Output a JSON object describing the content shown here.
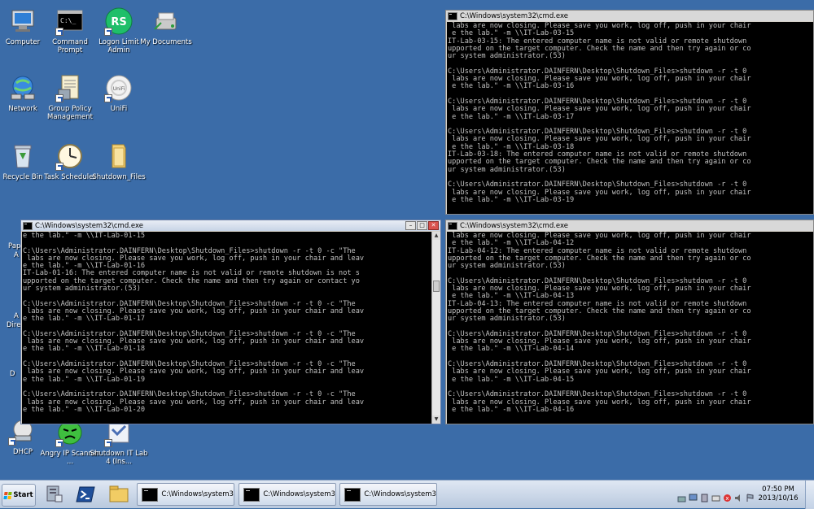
{
  "desktop": {
    "icons": [
      {
        "label": "Computer",
        "icon": "computer-icon"
      },
      {
        "label": "Command Prompt",
        "icon": "command-prompt-icon"
      },
      {
        "label": "Logon Limit Admin",
        "icon": "logon-limit-admin-icon",
        "badge": "RS"
      },
      {
        "label": "My Documents",
        "icon": "my-documents-icon"
      },
      {
        "label": "Network",
        "icon": "network-icon"
      },
      {
        "label": "Group Policy Management",
        "icon": "group-policy-icon"
      },
      {
        "label": "UniFi",
        "icon": "unifi-icon"
      },
      {
        "label": "Recycle Bin",
        "icon": "recycle-bin-icon"
      },
      {
        "label": "Task Scheduler",
        "icon": "task-scheduler-icon"
      },
      {
        "label": "Shutdown_Files",
        "icon": "folder-icon"
      },
      {
        "label": "DHCP",
        "icon": "dhcp-icon"
      },
      {
        "label": "Angry IP Scanner ...",
        "icon": "angry-ip-scanner-icon"
      },
      {
        "label": "Shutdown IT Lab 4 (Ins...",
        "icon": "shutdown-script-icon"
      }
    ],
    "partial_labels": [
      "Pap",
      "A",
      "A",
      "Dire",
      "D"
    ]
  },
  "windows": [
    {
      "title": "C:\\Windows\\system32\\cmd.exe",
      "lines": [
        " labs are now closing. Please save you work, log off, push in your chair",
        " e the lab.\" -m \\\\IT-Lab-03-15",
        "IT-Lab-03-15: The entered computer name is not valid or remote shutdown",
        "upported on the target computer. Check the name and then try again or co",
        "ur system administrator.(53)",
        "",
        "C:\\Users\\Administrator.DAINFERN\\Desktop\\Shutdown_Files>shutdown -r -t 0",
        " labs are now closing. Please save you work, log off, push in your chair",
        " e the lab.\" -m \\\\IT-Lab-03-16",
        "",
        "C:\\Users\\Administrator.DAINFERN\\Desktop\\Shutdown_Files>shutdown -r -t 0",
        " labs are now closing. Please save you work, log off, push in your chair",
        " e the lab.\" -m \\\\IT-Lab-03-17",
        "",
        "C:\\Users\\Administrator.DAINFERN\\Desktop\\Shutdown_Files>shutdown -r -t 0",
        " labs are now closing. Please save you work, log off, push in your chair",
        " e the lab.\" -m \\\\IT-Lab-03-18",
        "IT-Lab-03-18: The entered computer name is not valid or remote shutdown",
        "upported on the target computer. Check the name and then try again or co",
        "ur system administrator.(53)",
        "",
        "C:\\Users\\Administrator.DAINFERN\\Desktop\\Shutdown_Files>shutdown -r -t 0",
        " labs are now closing. Please save you work, log off, push in your chair",
        " e the lab.\" -m \\\\IT-Lab-03-19"
      ]
    },
    {
      "title": "C:\\Windows\\system32\\cmd.exe",
      "lines": [
        "e the lab.\" -m \\\\IT-Lab-01-15",
        "",
        "C:\\Users\\Administrator.DAINFERN\\Desktop\\Shutdown_Files>shutdown -r -t 0 -c \"The",
        " labs are now closing. Please save you work, log off, push in your chair and leav",
        "e the lab.\" -m \\\\IT-Lab-01-16",
        "IT-Lab-01-16: The entered computer name is not valid or remote shutdown is not s",
        "upported on the target computer. Check the name and then try again or contact yo",
        "ur system administrator.(53)",
        "",
        "C:\\Users\\Administrator.DAINFERN\\Desktop\\Shutdown_Files>shutdown -r -t 0 -c \"The",
        " labs are now closing. Please save you work, log off, push in your chair and leav",
        "e the lab.\" -m \\\\IT-Lab-01-17",
        "",
        "C:\\Users\\Administrator.DAINFERN\\Desktop\\Shutdown_Files>shutdown -r -t 0 -c \"The",
        " labs are now closing. Please save you work, log off, push in your chair and leav",
        "e the lab.\" -m \\\\IT-Lab-01-18",
        "",
        "C:\\Users\\Administrator.DAINFERN\\Desktop\\Shutdown_Files>shutdown -r -t 0 -c \"The",
        " labs are now closing. Please save you work, log off, push in your chair and leav",
        "e the lab.\" -m \\\\IT-Lab-01-19",
        "",
        "C:\\Users\\Administrator.DAINFERN\\Desktop\\Shutdown_Files>shutdown -r -t 0 -c \"The",
        " labs are now closing. Please save you work, log off, push in your chair and leav",
        "e the lab.\" -m \\\\IT-Lab-01-20"
      ]
    },
    {
      "title": "C:\\Windows\\system32\\cmd.exe",
      "lines": [
        " labs are now closing. Please save you work, log off, push in your chair",
        " e the lab.\" -m \\\\IT-Lab-04-12",
        "IT-Lab-04-12: The entered computer name is not valid or remote shutdown",
        "upported on the target computer. Check the name and then try again or co",
        "ur system administrator.(53)",
        "",
        "C:\\Users\\Administrator.DAINFERN\\Desktop\\Shutdown_Files>shutdown -r -t 0",
        " labs are now closing. Please save you work, log off, push in your chair",
        " e the lab.\" -m \\\\IT-Lab-04-13",
        "IT-Lab-04-13: The entered computer name is not valid or remote shutdown",
        "upported on the target computer. Check the name and then try again or co",
        "ur system administrator.(53)",
        "",
        "C:\\Users\\Administrator.DAINFERN\\Desktop\\Shutdown_Files>shutdown -r -t 0",
        " labs are now closing. Please save you work, log off, push in your chair",
        " e the lab.\" -m \\\\IT-Lab-04-14",
        "",
        "C:\\Users\\Administrator.DAINFERN\\Desktop\\Shutdown_Files>shutdown -r -t 0",
        " labs are now closing. Please save you work, log off, push in your chair",
        " e the lab.\" -m \\\\IT-Lab-04-15",
        "",
        "C:\\Users\\Administrator.DAINFERN\\Desktop\\Shutdown_Files>shutdown -r -t 0",
        " labs are now closing. Please save you work, log off, push in your chair",
        " e the lab.\" -m \\\\IT-Lab-04-16"
      ]
    }
  ],
  "taskbar": {
    "start_label": "Start",
    "buttons": [
      {
        "label": "C:\\Windows\\system3..."
      },
      {
        "label": "C:\\Windows\\system3..."
      },
      {
        "label": "C:\\Windows\\system3..."
      }
    ],
    "clock_time": "07:50 PM",
    "clock_date": "2013/10/16"
  },
  "colors": {
    "desktop": "#3b6ca8",
    "console_bg": "#000000",
    "console_text": "#c0c0c0",
    "close_button": "#d9534f"
  }
}
